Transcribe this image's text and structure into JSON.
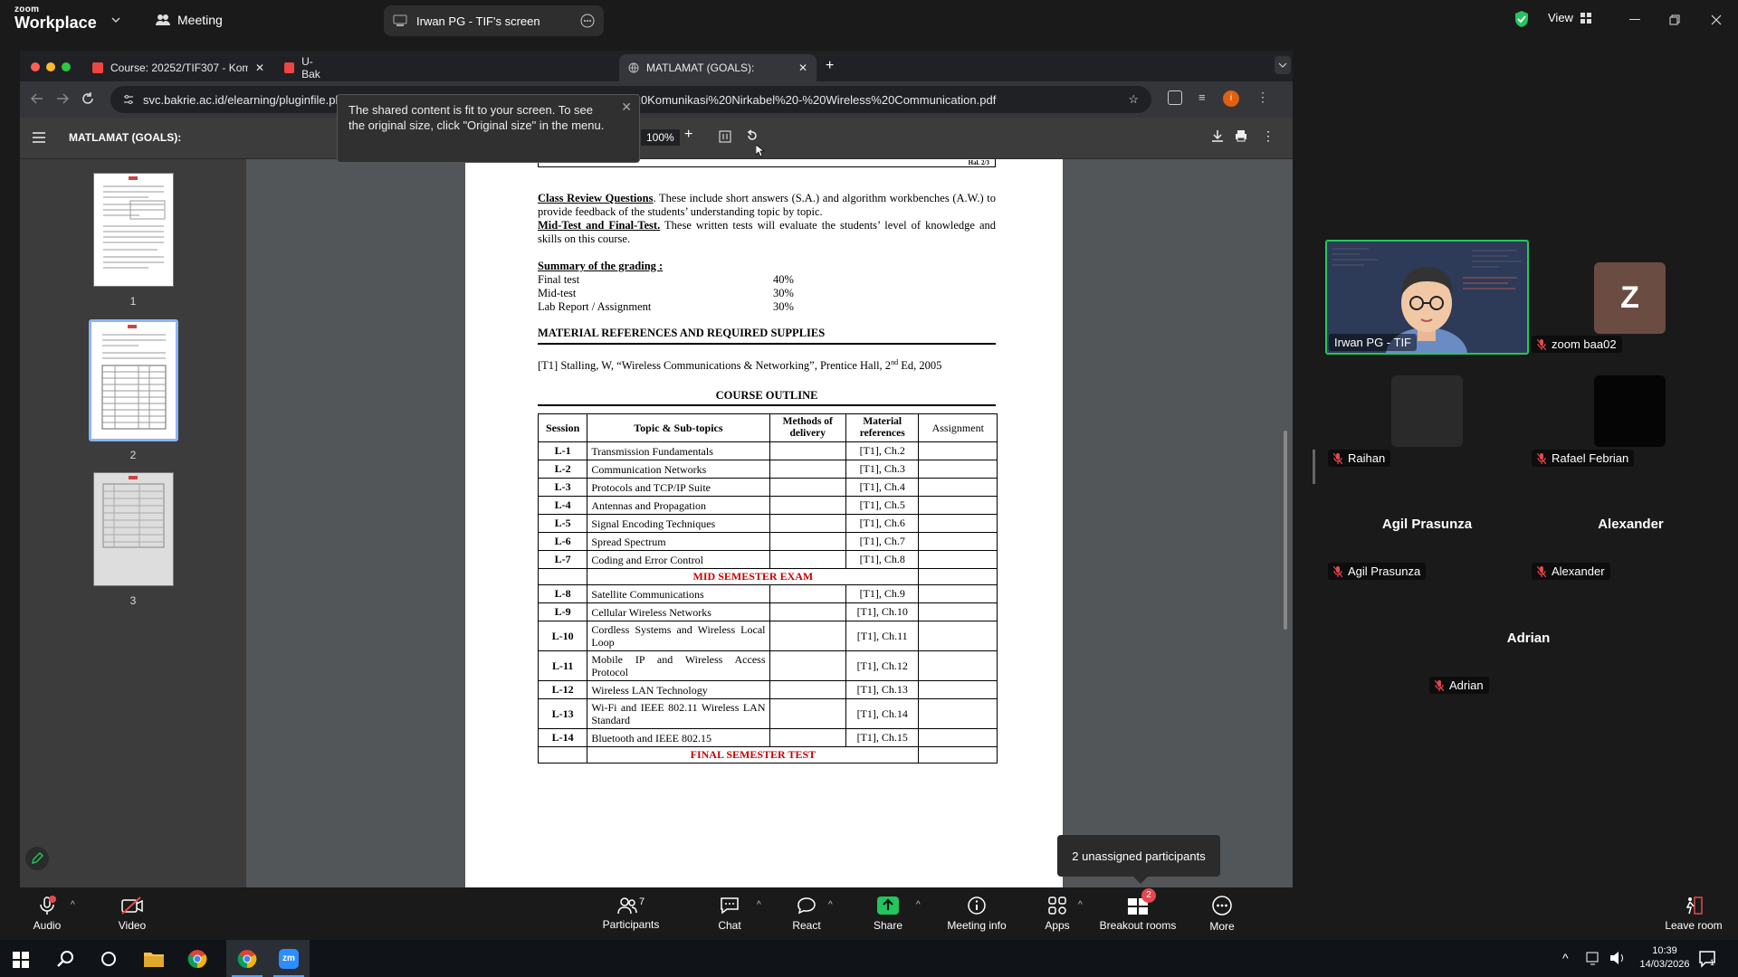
{
  "zoom": {
    "logo_top": "zoom",
    "logo_bottom": "Workplace",
    "meeting_label": "Meeting",
    "share_title": "Irwan PG - TIF's screen",
    "view_label": "View"
  },
  "toast": {
    "message": "The shared content is fit to your screen. To see the original size, click \"Original size\" in the menu."
  },
  "browser": {
    "tabs": [
      {
        "label": "Course: 20252/TIF307 - Kom"
      },
      {
        "label": "U-Bak"
      },
      {
        "label": "MATLAMAT (GOALS):"
      }
    ],
    "url": "svc.bakrie.ac.id/elearning/pluginfile.php/241042/mod_resource/content/1/Silabus%20TIF307%20Komunikasi%20Nirkabel%20-%20Wireless%20Communication.pdf"
  },
  "pdf": {
    "title": "MATLAMAT (GOALS):",
    "page_current": "2",
    "page_sep": "/",
    "page_total": "3",
    "zoom": "100%",
    "thumbs": [
      "1",
      "2",
      "3"
    ]
  },
  "doc": {
    "hal": "Hal. 2/3",
    "p1_head": "Class Review Questions",
    "p1_text": ". These include short answers (S.A.) and algorithm workbenches (A.W.) to provide feedback of the students’ understanding topic by topic.",
    "p2_head": "Mid-Test and Final-Test.",
    "p2_text": " These written tests will evaluate the students’ level of knowledge and skills on this course.",
    "summary_head": "Summary of the grading :",
    "grading": [
      {
        "item": "Final test",
        "pct": "40%"
      },
      {
        "item": "Mid-test",
        "pct": "30%"
      },
      {
        "item": "Lab Report / Assignment",
        "pct": "30%"
      }
    ],
    "refs_head": "MATERIAL REFERENCES AND REQUIRED SUPPLIES",
    "ref1_a": "[T1] Stalling, W, “Wireless Communications & Networking”, Prentice Hall, 2",
    "ref1_sup": "nd",
    "ref1_b": " Ed, 2005",
    "outline_head": "COURSE OUTLINE",
    "columns": [
      "Session",
      "Topic & Sub-topics",
      "Methods of delivery",
      "Material references",
      "Assignment"
    ],
    "rows_a": [
      {
        "s": "L-1",
        "t": "Transmission Fundamentals",
        "r": "[T1], Ch.2"
      },
      {
        "s": "L-2",
        "t": "Communication Networks",
        "r": "[T1], Ch.3"
      },
      {
        "s": "L-3",
        "t": "Protocols and TCP/IP Suite",
        "r": "[T1], Ch.4"
      },
      {
        "s": "L-4",
        "t": "Antennas and Propagation",
        "r": "[T1], Ch.5"
      },
      {
        "s": "L-5",
        "t": "Signal Encoding Techniques",
        "r": "[T1], Ch.6"
      },
      {
        "s": "L-6",
        "t": "Spread Spectrum",
        "r": "[T1], Ch.7"
      },
      {
        "s": "L-7",
        "t": "Coding and Error Control",
        "r": "[T1], Ch.8"
      }
    ],
    "mid_exam": "MID SEMESTER EXAM",
    "rows_b": [
      {
        "s": "L-8",
        "t": "Satellite Communications",
        "r": "[T1], Ch.9"
      },
      {
        "s": "L-9",
        "t": "Cellular Wireless Networks",
        "r": "[T1], Ch.10"
      },
      {
        "s": "L-10",
        "t": "Cordless Systems and Wireless Local Loop",
        "r": "[T1], Ch.11"
      },
      {
        "s": "L-11",
        "t": "Mobile IP and Wireless Access Protocol",
        "r": "[T1], Ch.12"
      },
      {
        "s": "L-12",
        "t": "Wireless LAN Technology",
        "r": "[T1], Ch.13"
      },
      {
        "s": "L-13",
        "t": "Wi-Fi and IEEE 802.11 Wireless LAN Standard",
        "r": "[T1], Ch.14"
      },
      {
        "s": "L-14",
        "t": "Bluetooth and IEEE 802.15",
        "r": "[T1], Ch.15"
      }
    ],
    "final_exam": "FINAL SEMESTER TEST"
  },
  "participants": {
    "self_name": "Irwan PG - TIF",
    "z_letter": "Z",
    "z_name": "zoom baa02",
    "raihan": "Raihan",
    "rafael": "Rafael Febrian",
    "agil_big": "Agil Prasunza",
    "agil": "Agil Prasunza",
    "alex_big": "Alexander",
    "alex": "Alexander",
    "adrian_big": "Adrian",
    "adrian": "Adrian",
    "unassigned": "2 unassigned participants"
  },
  "toolbar": {
    "audio": "Audio",
    "video": "Video",
    "participants": "Participants",
    "participants_count": "7",
    "chat": "Chat",
    "react": "React",
    "share": "Share",
    "meeting_info": "Meeting info",
    "apps": "Apps",
    "breakout": "Breakout rooms",
    "breakout_badge": "2",
    "more": "More",
    "leave": "Leave room"
  },
  "taskbar": {
    "time": "10:39",
    "date": "14/03/2026",
    "notif": "1"
  },
  "colors": {
    "active_speaker": "#24c95a",
    "share_green": "#22c55e",
    "exam_red": "#cc0000",
    "muted_red": "#e5484d"
  }
}
